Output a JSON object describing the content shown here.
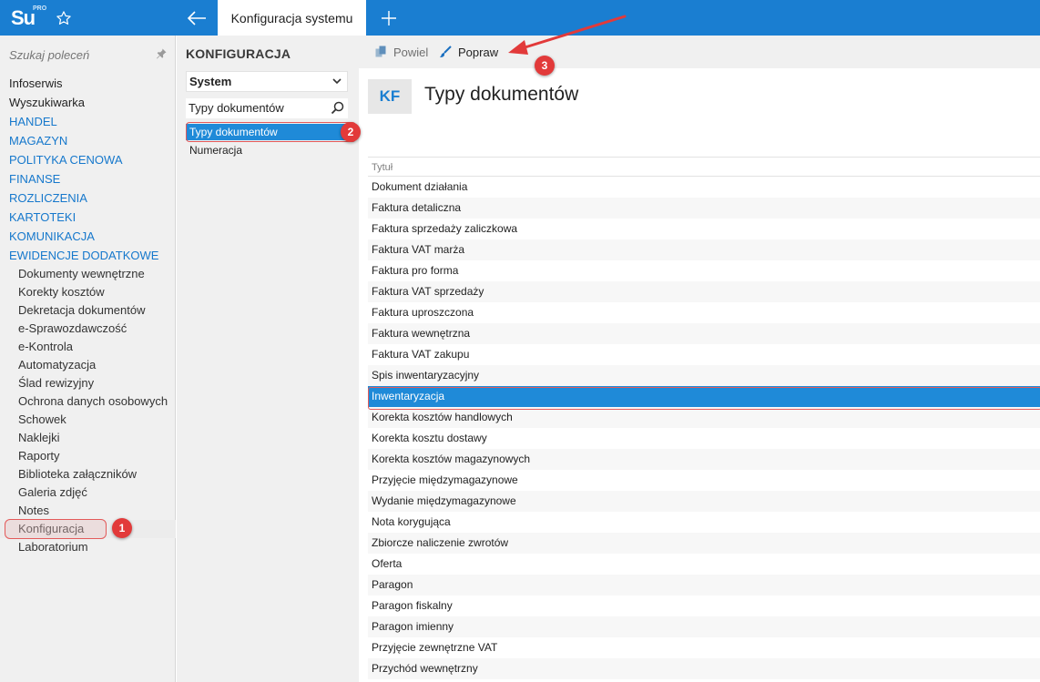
{
  "app": {
    "logo_text": "Su",
    "logo_sup": "PRO",
    "active_tab": "Konfiguracja systemu"
  },
  "sidebar": {
    "search_placeholder": "Szukaj poleceń",
    "items": [
      {
        "label": "Infoserwis",
        "section": false
      },
      {
        "label": "Wyszukiwarka",
        "section": false
      },
      {
        "label": "HANDEL",
        "section": true
      },
      {
        "label": "MAGAZYN",
        "section": true
      },
      {
        "label": "POLITYKA CENOWA",
        "section": true
      },
      {
        "label": "FINANSE",
        "section": true
      },
      {
        "label": "ROZLICZENIA",
        "section": true
      },
      {
        "label": "KARTOTEKI",
        "section": true
      },
      {
        "label": "KOMUNIKACJA",
        "section": true
      },
      {
        "label": "EWIDENCJE DODATKOWE",
        "section": true
      }
    ],
    "sub_items": [
      "Dokumenty wewnętrzne",
      "Korekty kosztów",
      "Dekretacja dokumentów",
      "e-Sprawozdawczość",
      "e-Kontrola",
      "Automatyzacja",
      "Ślad rewizyjny",
      "Ochrona danych osobowych",
      "Schowek",
      "Naklejki",
      "Raporty",
      "Biblioteka załączników",
      "Galeria zdjęć",
      "Notes",
      "Konfiguracja",
      "Laboratorium"
    ]
  },
  "config_panel": {
    "title": "KONFIGURACJA",
    "select_value": "System",
    "search_value": "Typy dokumentów",
    "tree": [
      "Typy dokumentów",
      "Numeracja"
    ]
  },
  "toolbar": {
    "copy_label": "Powiel",
    "edit_label": "Popraw"
  },
  "header": {
    "badge": "KF",
    "title": "Typy dokumentów"
  },
  "grid": {
    "column": "Tytuł",
    "rows": [
      "Dokument działania",
      "Faktura detaliczna",
      "Faktura sprzedaży zaliczkowa",
      "Faktura VAT marża",
      "Faktura pro forma",
      "Faktura VAT sprzedaży",
      "Faktura uproszczona",
      "Faktura wewnętrzna",
      "Faktura VAT zakupu",
      "Spis inwentaryzacyjny",
      "Inwentaryzacja",
      "Korekta kosztów handlowych",
      "Korekta kosztu dostawy",
      "Korekta kosztów magazynowych",
      "Przyjęcie międzymagazynowe",
      "Wydanie międzymagazynowe",
      "Nota korygująca",
      "Zbiorcze naliczenie zwrotów",
      "Oferta",
      "Paragon",
      "Paragon fiskalny",
      "Paragon imienny",
      "Przyjęcie zewnętrzne VAT",
      "Przychód wewnętrzny"
    ]
  },
  "annotations": {
    "badge1": "1",
    "badge2": "2",
    "badge3": "3"
  },
  "colors": {
    "accent": "#1a7ed1",
    "selection": "#1f8ad8",
    "callout": "#e23a3a"
  }
}
